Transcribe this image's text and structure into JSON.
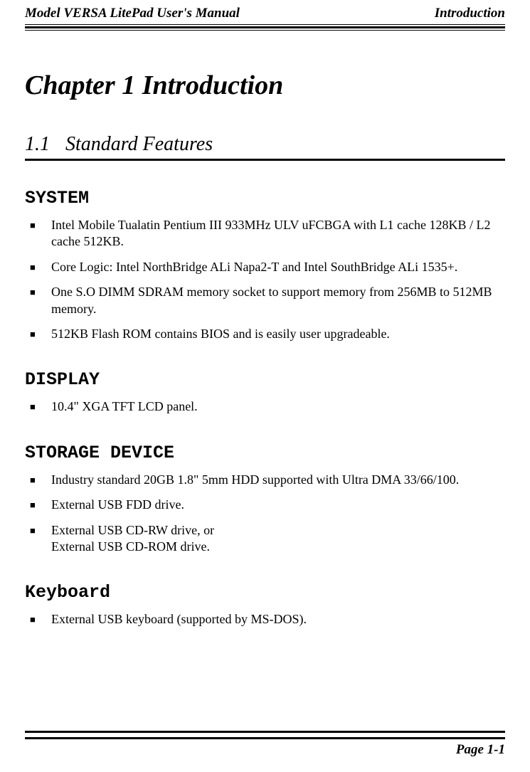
{
  "header": {
    "left": "Model VERSA LitePad User's Manual",
    "right": "Introduction"
  },
  "chapter_title": "Chapter 1 Introduction",
  "section": {
    "number": "1.1",
    "title": "Standard Features"
  },
  "system": {
    "heading": "SYSTEM",
    "items": [
      "Intel Mobile Tualatin Pentium III 933MHz ULV uFCBGA with L1 cache 128KB / L2 cache 512KB.",
      "Core Logic: Intel NorthBridge ALi Napa2-T and Intel SouthBridge ALi 1535+.",
      "One S.O DIMM SDRAM memory socket to support memory from 256MB to 512MB memory.",
      "512KB Flash ROM contains BIOS and is easily user upgradeable."
    ]
  },
  "display": {
    "heading": "DISPLAY",
    "items": [
      "10.4\" XGA TFT LCD panel."
    ]
  },
  "storage": {
    "heading": "STORAGE DEVICE",
    "items": [
      "Industry standard 20GB 1.8\" 5mm HDD supported with Ultra DMA 33/66/100.",
      "External USB FDD drive."
    ],
    "item3_line1": "External USB CD-RW drive, or",
    "item3_line2": "External USB CD-ROM drive."
  },
  "keyboard": {
    "heading": "Keyboard",
    "items": [
      "External USB keyboard (supported by MS-DOS)."
    ]
  },
  "footer": {
    "page": "Page 1-1"
  }
}
